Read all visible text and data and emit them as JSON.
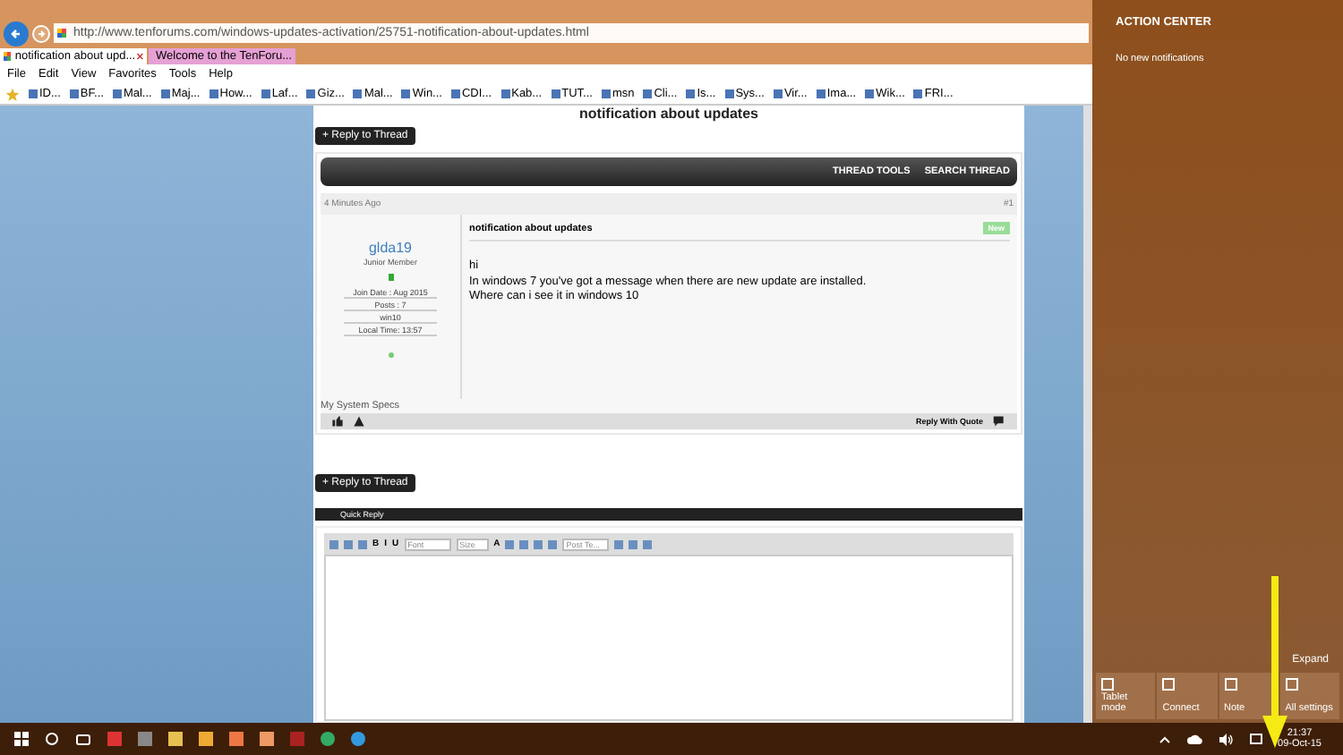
{
  "browser": {
    "url": "http://www.tenforums.com/windows-updates-activation/25751-notification-about-updates.html",
    "tabs": [
      {
        "label": "notification about upd...",
        "selected": true
      },
      {
        "label": "Welcome to the TenForu...",
        "selected": false
      }
    ],
    "menu": [
      "File",
      "Edit",
      "View",
      "Favorites",
      "Tools",
      "Help"
    ],
    "favorites": [
      "ID...",
      "BF...",
      "Mal...",
      "Maj...",
      "How...",
      "Laf...",
      "Giz...",
      "Mal...",
      "Win...",
      "CDI...",
      "Kab...",
      "TUT...",
      "msn",
      "Cli...",
      "Is...",
      "Sys...",
      "Vir...",
      "Ima...",
      "Wik...",
      "FRI..."
    ]
  },
  "page": {
    "thread_title": "notification about updates",
    "reply_button": "+ Reply to Thread",
    "thread_tools": [
      "THREAD TOOLS",
      "SEARCH THREAD"
    ],
    "post": {
      "time": "4 Minutes Ago",
      "number": "#1",
      "user": "glda19",
      "rank": "Junior Member",
      "stats": [
        "Join Date : Aug 2015",
        "Posts : 7",
        "win10",
        "Local Time: 13:57"
      ],
      "title": "notification about updates",
      "badge": "New",
      "body": [
        "hi",
        "In windows 7 you've got a message when there are new update are installed.",
        "Where can i see it in windows 10"
      ],
      "system_specs": "My System Specs",
      "reply_quote": "Reply With Quote"
    },
    "reply_button_bottom": "+ Reply to Thread",
    "quick_reply": "Quick Reply",
    "editor": {
      "format": [
        "B",
        "I",
        "U"
      ],
      "font": "Font",
      "size": "Size",
      "text_color": "A",
      "post_type": "Post Te..."
    }
  },
  "action_center": {
    "title": "ACTION CENTER",
    "message": "No new notifications",
    "expand": "Expand",
    "quick_actions": [
      "Tablet mode",
      "Connect",
      "Note",
      "All settings"
    ]
  },
  "taskbar": {
    "time": "21:37",
    "date": "09-Oct-15"
  }
}
